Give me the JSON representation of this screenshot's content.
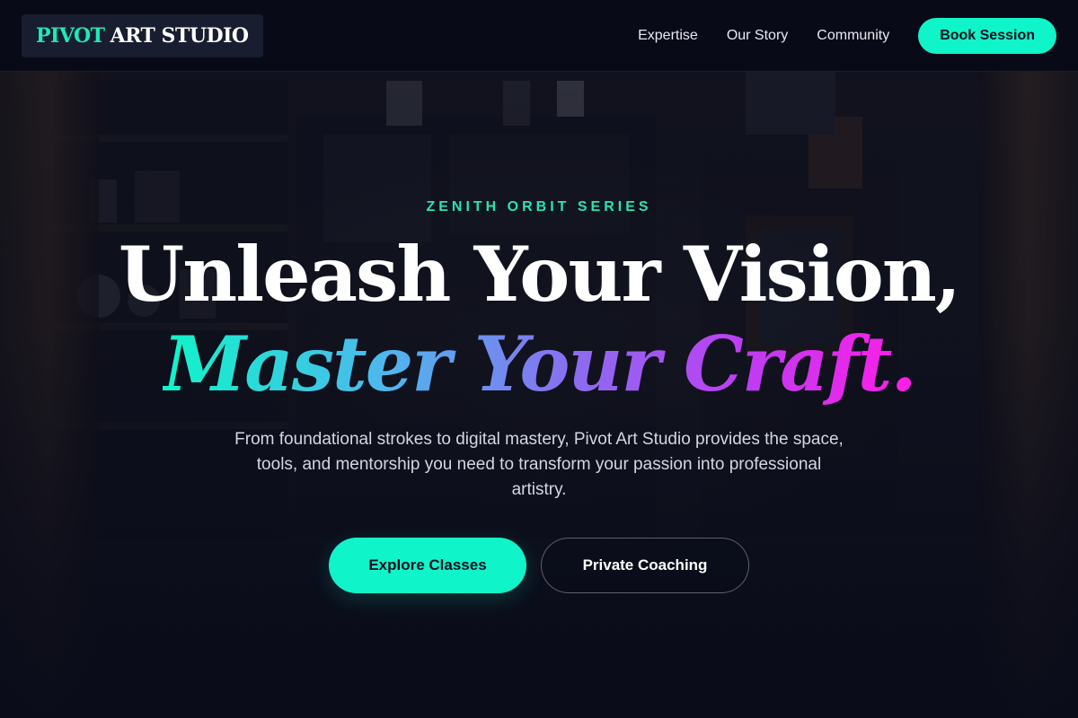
{
  "header": {
    "logo": {
      "accent_text": "PIVOT",
      "rest_text": "ART STUDIO"
    },
    "nav": {
      "items": [
        {
          "label": "Expertise"
        },
        {
          "label": "Our Story"
        },
        {
          "label": "Community"
        }
      ],
      "cta_label": "Book Session"
    }
  },
  "hero": {
    "eyebrow": "ZENITH ORBIT SERIES",
    "headline_line1": "Unleash Your Vision,",
    "headline_line2": "Master Your Craft.",
    "description": "From foundational strokes to digital mastery, Pivot Art Studio provides the space, tools, and mentorship you need to transform your passion into professional artistry.",
    "primary_cta": "Explore Classes",
    "secondary_cta": "Private Coaching"
  },
  "colors": {
    "accent": "#0ff5c9",
    "gradient_start": "#0ff5c9",
    "gradient_mid": "#8b6cf0",
    "gradient_end": "#ff1ce6",
    "background": "#0a0d1c"
  },
  "icons": {
    "background": "art-studio-background-photo"
  }
}
